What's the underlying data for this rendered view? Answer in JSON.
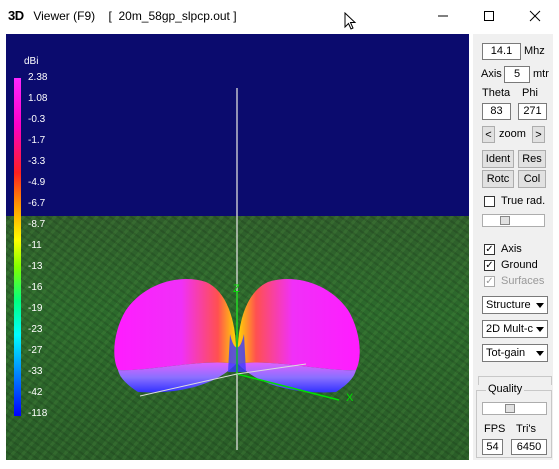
{
  "window": {
    "app_prefix": "3D",
    "title": " Viewer (F9)    [  20m_58gp_slpcp.out ]"
  },
  "scale": {
    "unit": "dBi",
    "labels": [
      "2.38",
      "1.08",
      "-0.3",
      "-1.7",
      "-3.3",
      "-4.9",
      "-6.7",
      "-8.7",
      "-11",
      "-13",
      "-16",
      "-19",
      "-23",
      "-27",
      "-33",
      "-42",
      "-118"
    ]
  },
  "axes": {
    "x_label": "X",
    "z_label": "Z"
  },
  "panel": {
    "freq_value": "14.1",
    "freq_unit": "Mhz",
    "axis_label": "Axis",
    "axis_value": "5",
    "axis_unit": "mtr",
    "theta_label": "Theta",
    "phi_label": "Phi",
    "theta_value": "83",
    "phi_value": "271",
    "zoom_prev": "<",
    "zoom_label": "zoom",
    "zoom_next": ">",
    "btn_ident": "Ident",
    "btn_res": "Res",
    "btn_rotc": "Rotc",
    "btn_col": "Col",
    "true_rad_label": "True rad.",
    "axis_check_label": "Axis",
    "ground_check_label": "Ground",
    "surfaces_check_label": "Surfaces",
    "select_view": "Structure",
    "select_mode": "2D Mult-c",
    "select_gain": "Tot-gain",
    "quality_label": "Quality",
    "fps_label": "FPS",
    "tris_label": "Tri's",
    "fps_value": "54",
    "tris_value": "6450"
  },
  "checks": {
    "true_rad": false,
    "axis": true,
    "ground": true,
    "surfaces": true
  }
}
